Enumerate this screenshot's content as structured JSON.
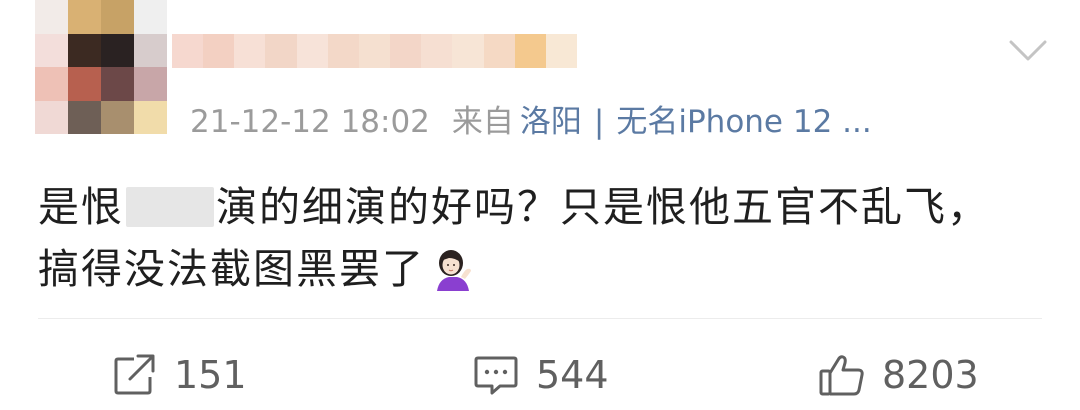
{
  "post": {
    "timestamp": "21-12-12 18:02",
    "source_prefix": "来自",
    "location": "洛阳",
    "separator": "|",
    "device": "无名iPhone 12 ...",
    "text_line1_part1": "是恨",
    "text_line1_part2": "演的细演的好吗？只是恨他五官不乱飞，",
    "text_line2": "搞得没法截图黑罢了",
    "emoji_icon": "woman-tipping-hand-emoji"
  },
  "actions": {
    "forward_icon": "share-arrow-icon",
    "forward_count": "151",
    "comment_icon": "comment-bubble-icon",
    "comment_count": "544",
    "like_icon": "thumbs-up-icon",
    "like_count": "8203"
  },
  "colors": {
    "meta_gray": "#9b9b9b",
    "link_blue": "#5b7aa3",
    "text": "#1f1f1f",
    "action_gray": "#606060"
  }
}
